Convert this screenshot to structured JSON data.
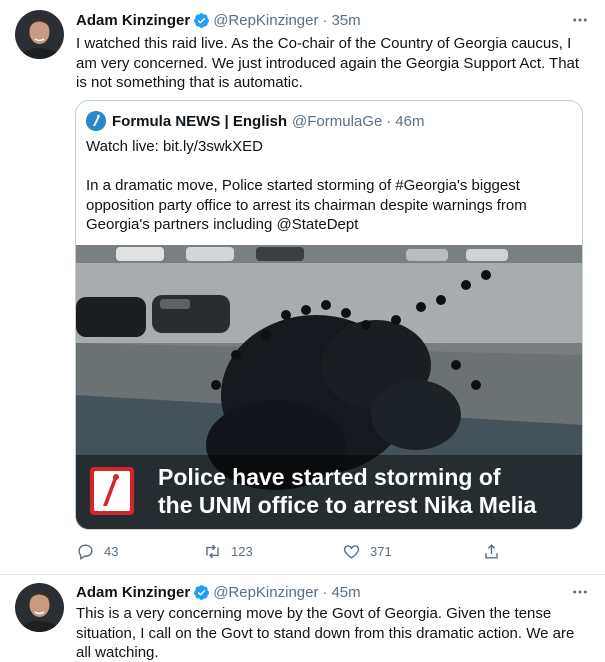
{
  "tweets": [
    {
      "author": "Adam Kinzinger",
      "handle": "@RepKinzinger",
      "separator": "·",
      "time": "35m",
      "text": "I watched this raid live.  As the Co-chair of the Country of Georgia caucus, I am very concerned.  We just introduced again the Georgia Support Act.  That is not something that is automatic.",
      "quote": {
        "author": "Formula NEWS | English",
        "handle": "@FormulaGe",
        "separator": "·",
        "time": "46m",
        "line1": "Watch live: bit.ly/3swkXED",
        "line2": "In a dramatic move, Police started storming of #Georgia's biggest opposition party office to arrest its chairman despite warnings from Georgia's partners including @StateDept",
        "media_caption_line1": "Police have started storming of",
        "media_caption_line2": "the UNM office to arrest Nika Melia"
      },
      "actions": {
        "replies": "43",
        "retweets": "123",
        "likes": "371"
      }
    },
    {
      "author": "Adam Kinzinger",
      "handle": "@RepKinzinger",
      "separator": "·",
      "time": "45m",
      "text": "This is a very concerning move by the Govt of Georgia. Given the tense situation, I call on the Govt to stand down from this dramatic action.  We are all watching."
    }
  ],
  "colors": {
    "verified": "#1da1f2",
    "secondary_text": "#5b7083",
    "border": "#c4cfd6",
    "caption_logo": "#d3262b"
  },
  "icons": [
    "verified-badge-icon",
    "more-options-icon",
    "reply-icon",
    "retweet-icon",
    "like-icon",
    "share-icon"
  ]
}
